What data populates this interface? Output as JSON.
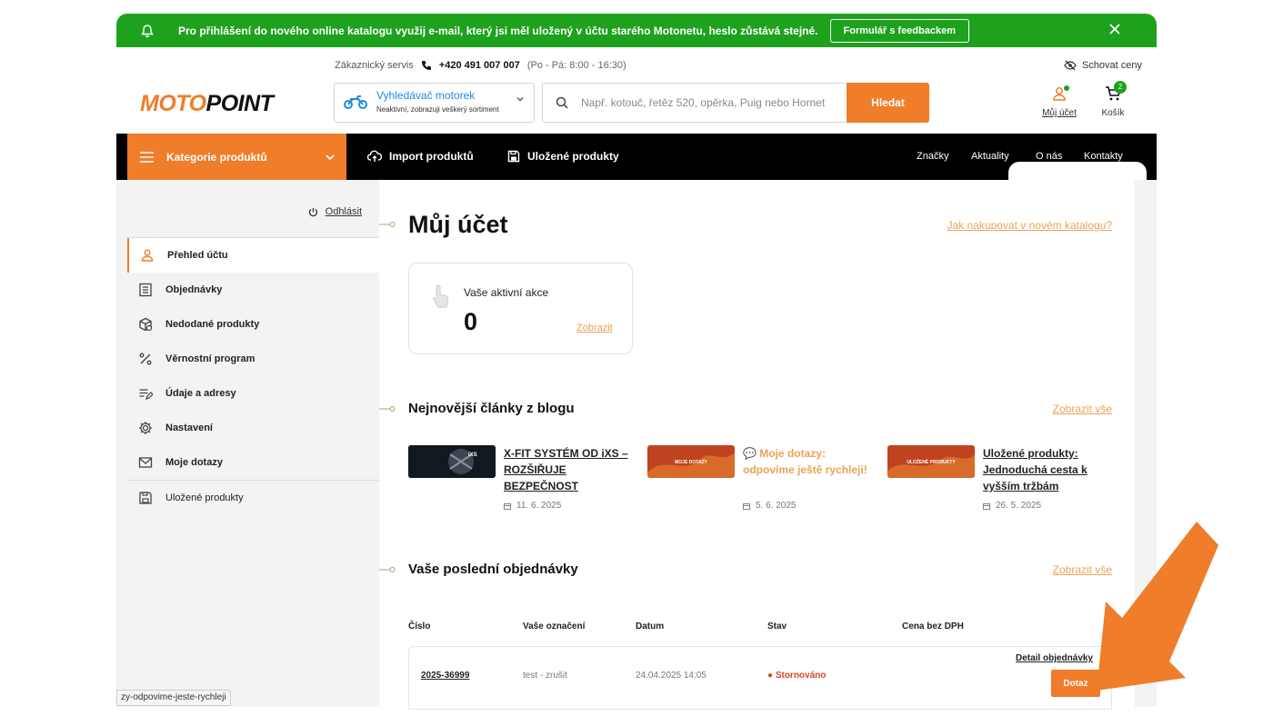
{
  "banner": {
    "message": "Pro přihlášení do nového online katalogu využij e-mail, který jsi měl uložený v účtu starého Motonetu, heslo zůstává stejné.",
    "feedback_button": "Formulář s feedbackem",
    "icon": "bell-icon"
  },
  "header": {
    "logo_moto": "MOTO",
    "logo_point": "POINT",
    "service_label": "Zákaznický servis",
    "phone": "+420 491 007 007",
    "hours": "(Po - Pá: 8:00 - 16:30)",
    "bike_finder_title": "Vyhledávač motorek",
    "bike_finder_sub": "Neaktivní, zobrazuji veškerý sortiment",
    "search_placeholder": "Např. kotouč, řetěz 520, opěrka, Puig nebo Hornet",
    "search_button": "Hledat",
    "hide_prices": "Schovat ceny",
    "account_label": "Můj účet",
    "cart_label": "Košík",
    "cart_count": "2"
  },
  "nav": {
    "categories": "Kategorie produktů",
    "import": "Import produktů",
    "saved": "Uložené produkty",
    "right": [
      "Značky",
      "Aktuality",
      "O nás",
      "Kontakty"
    ]
  },
  "sidebar": {
    "logout": "Odhlásit",
    "items": [
      {
        "label": "Přehled účtu",
        "icon": "user-icon"
      },
      {
        "label": "Objednávky",
        "icon": "list-icon"
      },
      {
        "label": "Nedodané produkty",
        "icon": "box-icon"
      },
      {
        "label": "Věrnostní program",
        "icon": "percent-icon"
      },
      {
        "label": "Údaje a adresy",
        "icon": "edit-list-icon"
      },
      {
        "label": "Nastavení",
        "icon": "gear-icon"
      },
      {
        "label": "Moje dotazy",
        "icon": "mail-icon"
      },
      {
        "label": "Uložené produkty",
        "icon": "save-icon"
      }
    ]
  },
  "main": {
    "title": "Můj účet",
    "help_link": "Jak nakupovat v novém katalogu?",
    "actions_title": "Vaše aktivní akce",
    "actions_count": "0",
    "actions_link": "Zobrazit",
    "blog_title": "Nejnovější články z blogu",
    "blog_link": "Zobrazit vše",
    "blog": [
      {
        "title": "X-FIT SYSTÉM OD iXS – ROZŠIŘUJE BEZPEČNOST",
        "date": "11. 6. 2025",
        "thumb_text": "iXS",
        "thumb_color": "#111820"
      },
      {
        "title": "💬 Moje dotazy: odpovíme ještě rychleji!",
        "date": "5. 6. 2025",
        "thumb_text": "MOJE DOTAZY",
        "thumb_color": "#c0431f"
      },
      {
        "title": "Uložené produkty: Jednoduchá cesta k vyšším tržbám",
        "date": "26. 5. 2025",
        "thumb_text": "ULOŽENÉ PRODUKTY",
        "thumb_color": "#c0431f"
      }
    ],
    "orders_title": "Vaše poslední objednávky",
    "orders_link": "Zobrazit vše",
    "table_headers": [
      "Číslo",
      "Vaše označení",
      "Datum",
      "Stav",
      "Cena bez DPH"
    ],
    "orders": [
      {
        "number": "2025-36999",
        "label": "test - zrušit",
        "date": "24.04.2025 14:05",
        "status": "● Stornováno",
        "detail": "Detail objednávky",
        "action": "Dotaz"
      }
    ]
  },
  "status_url": "zy-odpovime-jeste-rychleji",
  "colors": {
    "accent": "#ef7d2a",
    "banner": "#1ea21e",
    "link": "#e8a35a",
    "status_cancelled": "#d9442b"
  }
}
